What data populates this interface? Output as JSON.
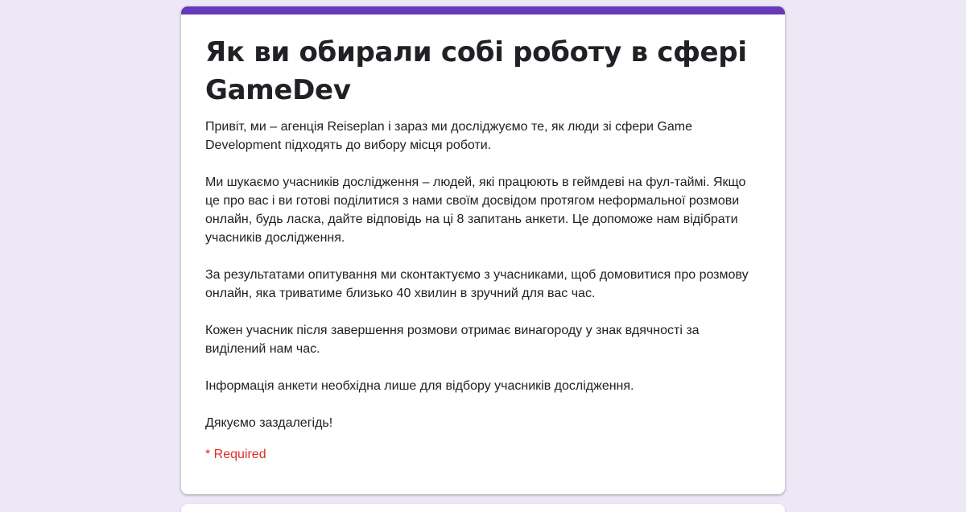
{
  "theme": {
    "accent": "#673ab7",
    "background": "#ede7f6",
    "required_color": "#d93025"
  },
  "form": {
    "title": "Як ви обирали собі роботу в сфері GameDev",
    "description": [
      "Привіт, ми – агенція Reiseplan і зараз ми досліджуємо те, як люди зі сфери Game Development підходять до вибору місця роботи.",
      "Ми шукаємо учасників дослідження – людей, які працюють в геймдеві на фул-таймі. Якщо це про вас і ви готові поділитися з нами своїм досвідом протягом неформальної розмови онлайн, будь ласка, дайте відповідь на ці 8 запитань анкети. Це допоможе нам відібрати учасників дослідження.",
      "За результатами опитування ми сконтактуємо з учасниками, щоб домовитися про розмову онлайн, яка триватиме близько 40 хвилин в зручний для вас час.",
      "Кожен учасник після завершення розмови отримає винагороду у знак вдячності за виділений нам час.",
      "Інформація анкети необхідна лише для відбору учасників дослідження.",
      "Дякуємо заздалегідь!"
    ],
    "required_note": "* Required"
  }
}
